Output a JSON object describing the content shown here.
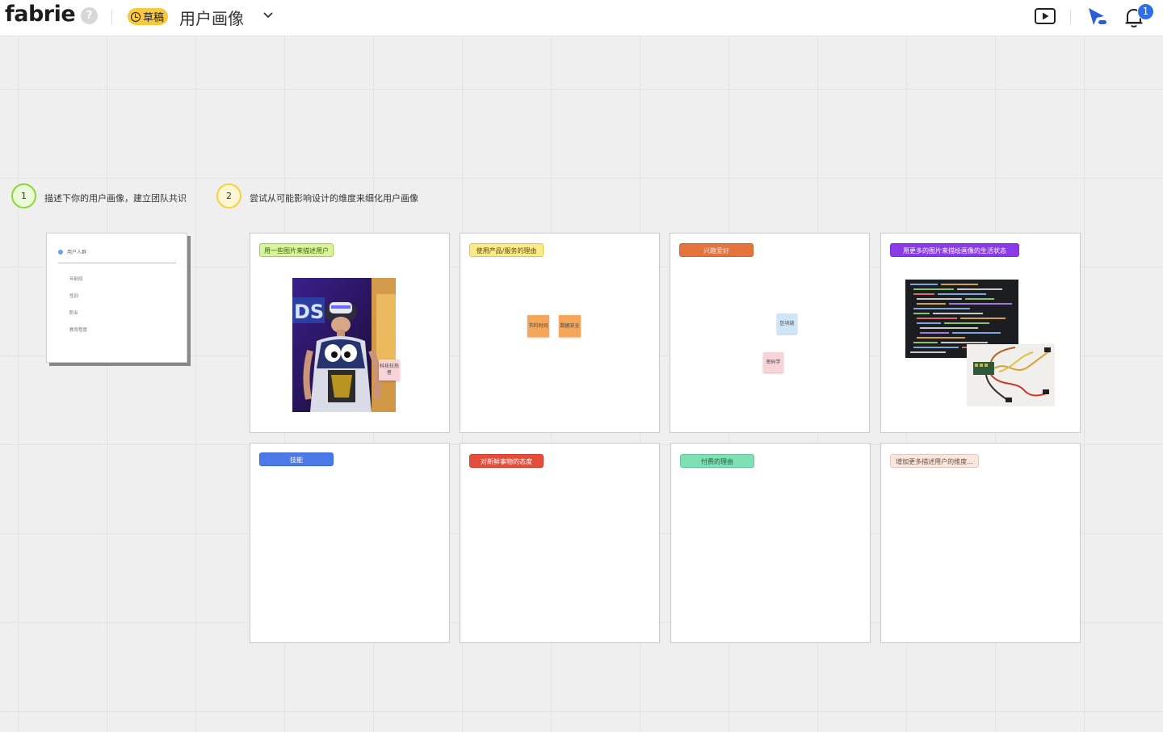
{
  "app": {
    "logo": "fabrie",
    "help_label": "?",
    "draft_label": "草稿",
    "doc_title": "用户画像",
    "notification_count": "1"
  },
  "steps": [
    {
      "number": "1",
      "text": "描述下你的用户画像，建立团队共识",
      "color": "#8cd63c"
    },
    {
      "number": "2",
      "text": "尝试从可能影响设计的维度来细化用户画像",
      "color": "#f3d33d"
    }
  ],
  "template": {
    "header": "用户人群",
    "fields": [
      "年龄段",
      "性别",
      "职业",
      "教育程度"
    ]
  },
  "cards": [
    {
      "tag": "用一些图片来描述用户",
      "tag_bg": "#d9f59a",
      "tag_border": "#9ccf4a",
      "tag_color": "#3a5a0f"
    },
    {
      "tag": "使用产品/服务的理由",
      "tag_bg": "#fbe98a",
      "tag_border": "#e4c640",
      "tag_color": "#5a4a0a"
    },
    {
      "tag": "兴趣爱好",
      "tag_bg": "#e2743c",
      "tag_border": "#d06428",
      "tag_color": "#fbe2d2"
    },
    {
      "tag": "用更多的图片来描绘画像的生活状态",
      "tag_bg": "#8a3ae6",
      "tag_border": "#7a2bd8",
      "tag_color": "#ffffff"
    },
    {
      "tag": "技能",
      "tag_bg": "#4c79e8",
      "tag_border": "#3c69d8",
      "tag_color": "#ffffff"
    },
    {
      "tag": "对新鲜事物的态度",
      "tag_bg": "#e44d3a",
      "tag_border": "#d23d2a",
      "tag_color": "#ffffff"
    },
    {
      "tag": "付费的理由",
      "tag_bg": "#7fe0b6",
      "tag_border": "#5fc896",
      "tag_color": "#215a40"
    },
    {
      "tag": "增加更多描述用户的维度...",
      "tag_bg": "#f8e7df",
      "tag_border": "#e4c8bb",
      "tag_color": "#6a4a3e"
    }
  ],
  "stickies": {
    "tech_fan": "科技狂热者",
    "save_time": "节约时间",
    "data_safety": "数据安全",
    "blockchain": "区块链",
    "cryptography": "密码学"
  },
  "photo": {
    "vr_sign": "DS"
  }
}
